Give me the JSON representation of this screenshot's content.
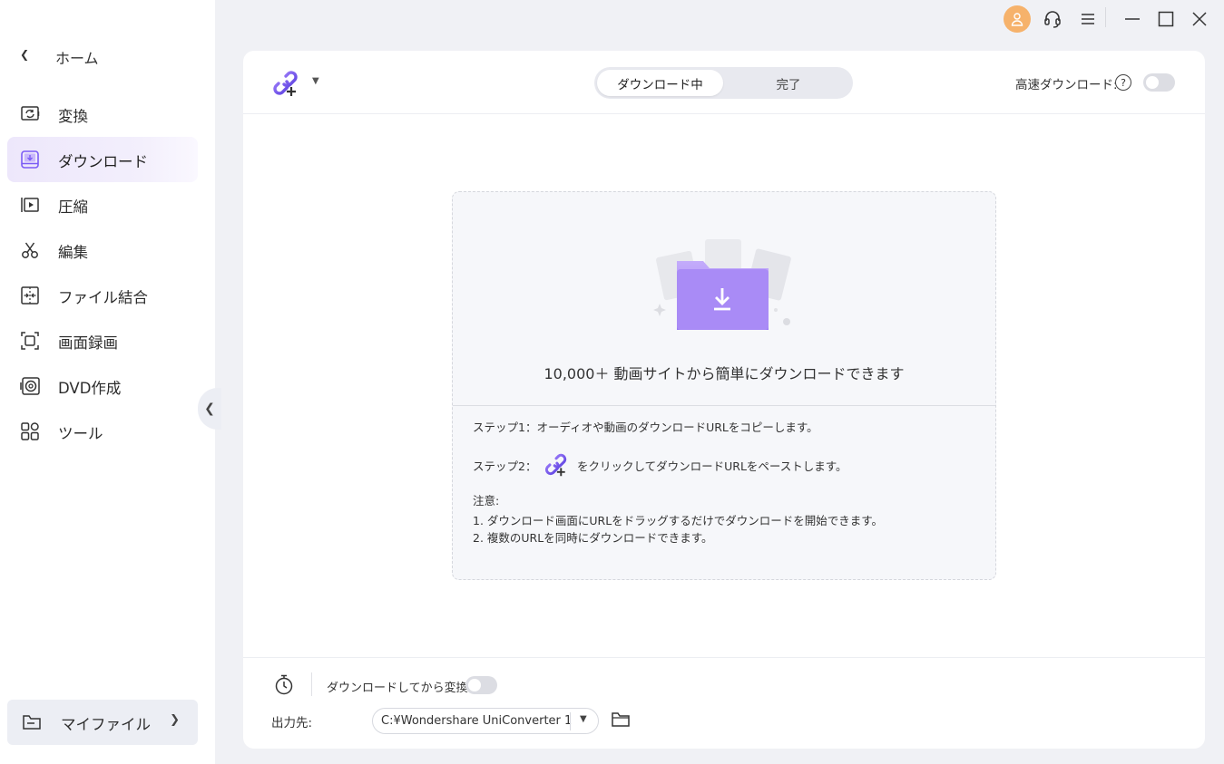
{
  "sidebar": {
    "home_label": "ホーム",
    "items": [
      {
        "label": "変換",
        "icon": "convert-icon"
      },
      {
        "label": "ダウンロード",
        "icon": "download-icon",
        "active": true
      },
      {
        "label": "圧縮",
        "icon": "compress-icon"
      },
      {
        "label": "編集",
        "icon": "scissors-icon"
      },
      {
        "label": "ファイル結合",
        "icon": "merge-icon"
      },
      {
        "label": "画面録画",
        "icon": "screen-record-icon"
      },
      {
        "label": "DVD作成",
        "icon": "dvd-icon"
      },
      {
        "label": "ツール",
        "icon": "toolbox-icon"
      }
    ],
    "myfile_label": "マイファイル"
  },
  "titlebar": {
    "colors": {
      "avatar": "#f6b26b"
    }
  },
  "header": {
    "tabs": [
      "ダウンロード中",
      "完了"
    ],
    "high_speed_label": "高速ダウンロード:",
    "help_glyph": "?"
  },
  "dropzone": {
    "headline": "10,000＋ 動画サイトから簡単にダウンロードできます",
    "step1": "ステップ1：オーディオや動画のダウンロードURLをコピーします。",
    "step2_prefix": "ステップ2：",
    "step2_suffix": "をクリックしてダウンロードURLをペーストします。",
    "note_title": "注意:",
    "note1": "1. ダウンロード画面にURLをドラッグするだけでダウンロードを開始できます。",
    "note2": "2. 複数のURLを同時にダウンロードできます。"
  },
  "footer": {
    "convert_after_label": "ダウンロードしてから変換:",
    "output_label": "出力先:",
    "output_path": "C:¥Wondershare UniConverter 1"
  },
  "colors": {
    "accent": "#7b5cf5",
    "sidebar_active": "#ede7fb",
    "folder": "#a98bf6"
  }
}
